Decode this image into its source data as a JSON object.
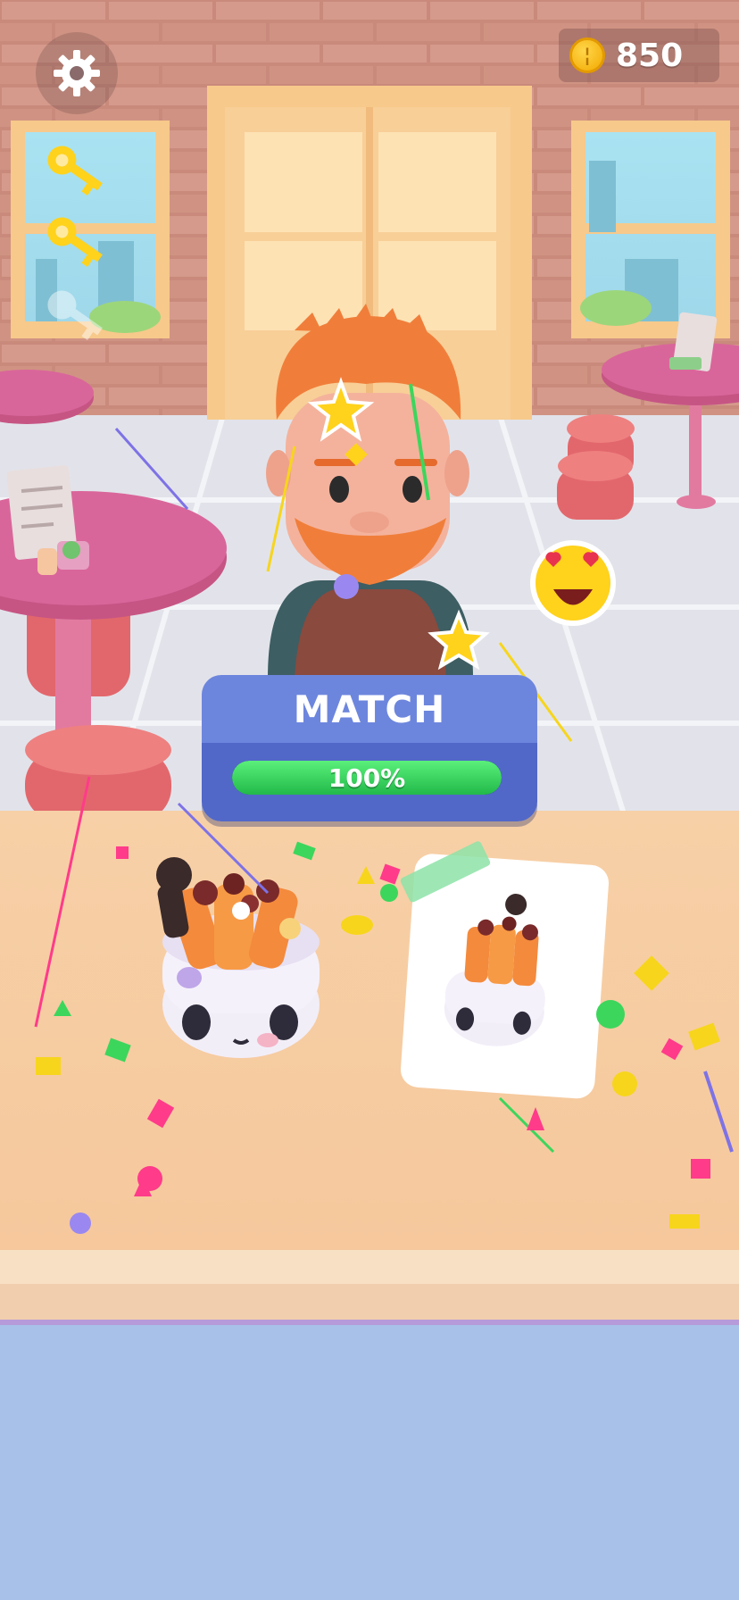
{
  "hud": {
    "coins": "850",
    "keys_collected": 2,
    "keys_total": 3,
    "settings_icon": "gear-icon",
    "coin_icon": "coin-icon"
  },
  "match": {
    "title": "MATCH",
    "percent_label": "100%",
    "progress": 1.0
  },
  "reaction": {
    "emoji": "heart-eyes-emoji"
  },
  "colors": {
    "match_panel_top": "#6d86dd",
    "match_panel_bottom": "#5168c8",
    "progress_fill": "#2fd15a",
    "counter": "#f8cfa3",
    "floor_bottom": "#a8c1e8"
  }
}
